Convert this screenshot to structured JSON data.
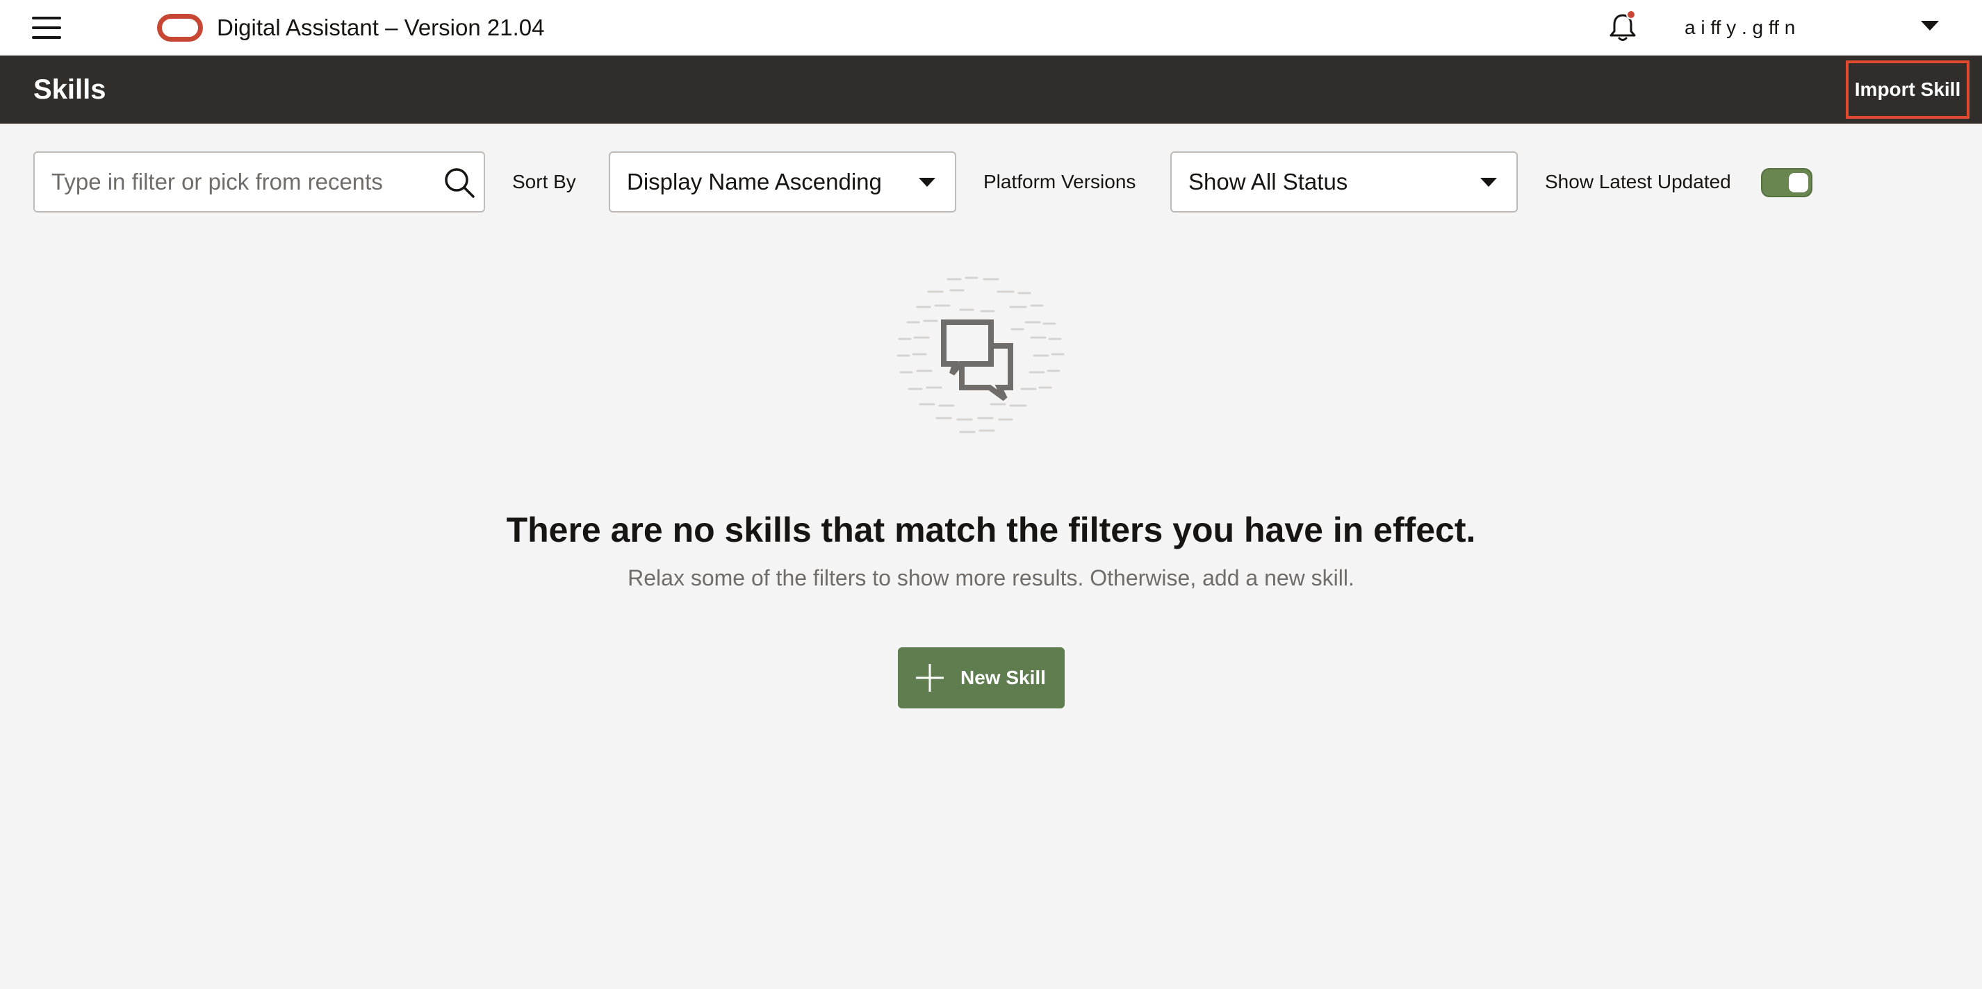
{
  "topbar": {
    "app_title": "Digital Assistant – Version 21.04",
    "user_name": "a  i   ff  y . g  ff  n",
    "icons": {
      "menu": "hamburger-menu-icon",
      "logo": "oracle-logo",
      "notifications": "bell-icon",
      "user_menu": "chevron-down-icon"
    },
    "notification_dot_color": "#c74634"
  },
  "header": {
    "title": "Skills",
    "import_label": "Import Skill",
    "highlight_color": "#e24a2f",
    "background_color": "#312d2a"
  },
  "filters": {
    "search_placeholder": "Type in filter or pick from recents",
    "search_value": "",
    "sort_label": "Sort By",
    "sort_selected": "Display Name Ascending",
    "platform_label": "Platform Versions",
    "platform_selected": "Show All Status",
    "latest_label": "Show Latest Updated",
    "latest_on": true,
    "toggle_color": "#6a8650"
  },
  "empty_state": {
    "icon": "chat-bubbles-icon",
    "heading": "There are no skills that match the filters you have in effect.",
    "subtext": "Relax some of the filters to show more results. Otherwise, add a new skill.",
    "new_skill_label": "New Skill",
    "button_color": "#5f7d4f"
  }
}
